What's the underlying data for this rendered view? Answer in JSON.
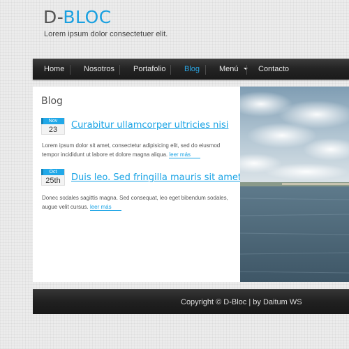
{
  "site": {
    "brand_prefix": "D-",
    "brand_accent": "BLOC",
    "tagline": "Lorem ipsum dolor consectetuer elit."
  },
  "nav": {
    "items": [
      {
        "label": "Home"
      },
      {
        "label": "Nosotros"
      },
      {
        "label": "Portafolio"
      },
      {
        "label": "Blog",
        "active": true
      },
      {
        "label": "Menú",
        "has_dropdown": true
      },
      {
        "label": "Contacto"
      }
    ]
  },
  "main": {
    "section_title": "Blog",
    "posts": [
      {
        "month": "Nov",
        "day": "23",
        "title": "Curabitur ullamcorper ultricies nisi",
        "excerpt": "Lorem ipsum dolor sit amet, consectetur adipisicing elit, sed do eiusmod tempor incididunt ut labore et dolore magna aliqua.",
        "read_more": "leer más"
      },
      {
        "month": "Oct",
        "day": "25th",
        "title": "Duis leo. Sed fringilla mauris sit amet nibh",
        "excerpt": "Donec sodales sagittis magna. Sed consequat, leo eget bibendum sodales, augue velit cursus.",
        "read_more": "leer más"
      }
    ]
  },
  "footer": {
    "text": "Copyright © D-Bloc | by Daitum WS"
  },
  "colors": {
    "accent": "#1aa0e0",
    "nav_background": "#242424",
    "panel_background": "#ffffff",
    "page_background": "#ececec"
  }
}
